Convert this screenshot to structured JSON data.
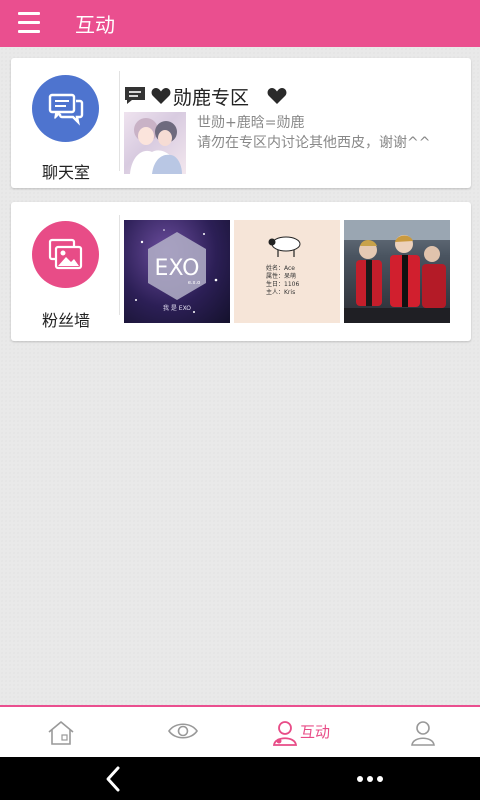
{
  "app_bar": {
    "title": "互动",
    "menu_icon": "hamburger-menu-icon",
    "color": "#ea4f8f"
  },
  "chat_card": {
    "label": "聊天室",
    "icon": "chat-bubbles-icon",
    "icon_color": "#4e74cf",
    "topic": {
      "title": "勋鹿专区",
      "line1": "世勋+鹿晗=勋鹿",
      "line2": "请勿在专区内讨论其他西皮，谢谢^^"
    }
  },
  "fans_card": {
    "label": "粉丝墙",
    "icon": "photo-gallery-icon",
    "icon_color": "#e84c87",
    "photos": [
      {
        "logo_text": "EXO",
        "small": "e.x.o",
        "caption": "我 是 EXO"
      },
      {
        "lines": [
          "姓名：Ace",
          "属性：呆萌",
          "生日：1106",
          "主人：Kris"
        ]
      },
      {
        "desc": "group-photo"
      }
    ]
  },
  "bottom_nav": {
    "items": [
      {
        "icon": "home-icon"
      },
      {
        "icon": "eye-icon"
      },
      {
        "icon": "person-icon",
        "label": "互动",
        "active": true
      },
      {
        "icon": "profile-icon"
      }
    ],
    "accent": "#ea4f8f"
  },
  "system_bar": {
    "back": "back-arrow-icon",
    "more": "more-dots-icon"
  }
}
